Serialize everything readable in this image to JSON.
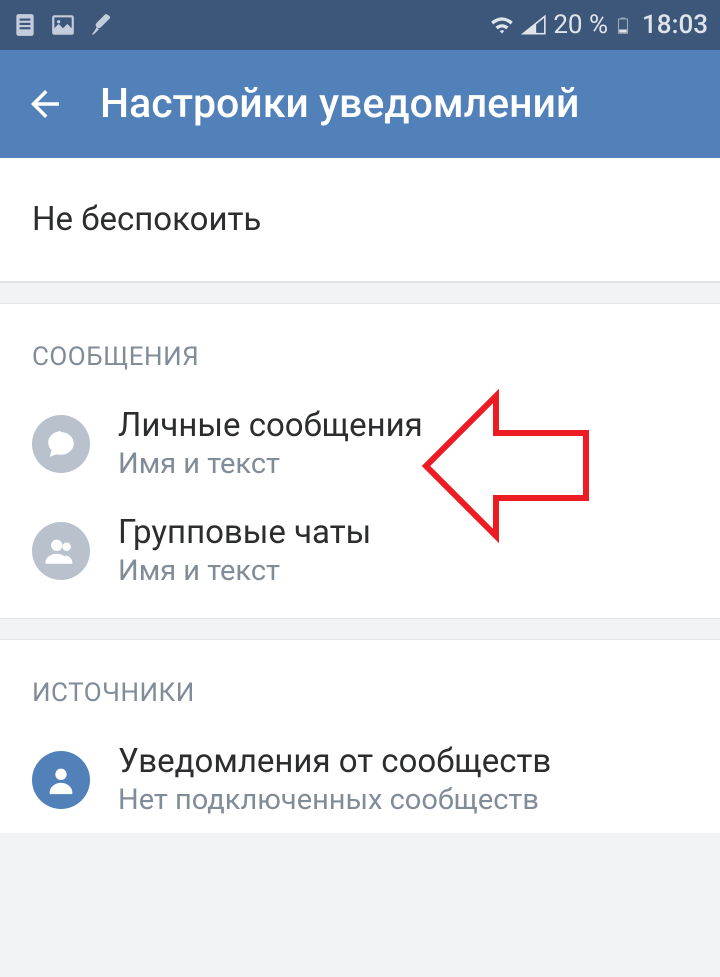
{
  "status": {
    "battery_pct": "20 %",
    "time": "18:03"
  },
  "header": {
    "title": "Настройки уведомлений"
  },
  "do_not_disturb": {
    "label": "Не беспокоить"
  },
  "sections": {
    "messages": {
      "header": "СООБЩЕНИЯ",
      "items": [
        {
          "primary": "Личные сообщения",
          "secondary": "Имя и текст"
        },
        {
          "primary": "Групповые чаты",
          "secondary": "Имя и текст"
        }
      ]
    },
    "sources": {
      "header": "ИСТОЧНИКИ",
      "items": [
        {
          "primary": "Уведомления от сообществ",
          "secondary": "Нет подключенных сообществ"
        }
      ]
    }
  }
}
